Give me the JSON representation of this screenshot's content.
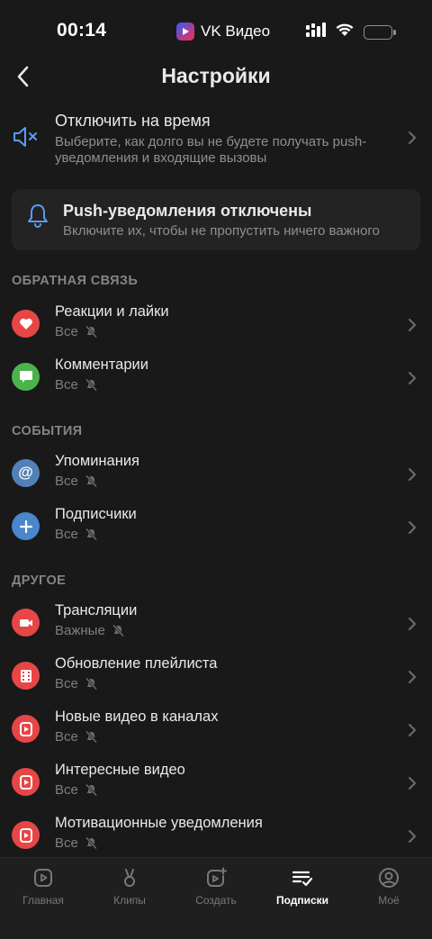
{
  "status_bar": {
    "time": "00:14",
    "app_name": "VK Видео",
    "battery_level": 0.22
  },
  "header": {
    "title": "Настройки"
  },
  "snooze": {
    "title": "Отключить на время",
    "description": "Выберите, как долго вы не будете получать push-уведомления и входящие вызовы"
  },
  "push_banner": {
    "title": "Push-уведомления отключены",
    "description": "Включите их, чтобы не пропустить ничего важного"
  },
  "sections": {
    "feedback": "ОБРАТНАЯ СВЯЗЬ",
    "events": "СОБЫТИЯ",
    "other": "ДРУГОЕ"
  },
  "rows": {
    "reactions": {
      "title": "Реакции и лайки",
      "sub": "Все",
      "icon": "heart-icon",
      "color": "#e64646"
    },
    "comments": {
      "title": "Комментарии",
      "sub": "Все",
      "icon": "comment-icon",
      "color": "#4bb34b"
    },
    "mentions": {
      "title": "Упоминания",
      "sub": "Все",
      "icon": "at-icon",
      "color": "#5181b8"
    },
    "subscribers": {
      "title": "Подписчики",
      "sub": "Все",
      "icon": "plus-icon",
      "color": "#4986cc"
    },
    "streams": {
      "title": "Трансляции",
      "sub": "Важные",
      "icon": "video-camera-icon",
      "color": "#e64646"
    },
    "playlist": {
      "title": "Обновление плейлиста",
      "sub": "Все",
      "icon": "film-icon",
      "color": "#e64646"
    },
    "channel_videos": {
      "title": "Новые видео в каналах",
      "sub": "Все",
      "icon": "play-icon",
      "color": "#e64646"
    },
    "interesting": {
      "title": "Интересные видео",
      "sub": "Все",
      "icon": "play-icon",
      "color": "#e64646"
    },
    "motivation": {
      "title": "Мотивационные уведомления",
      "sub": "Все",
      "icon": "play-icon",
      "color": "#e64646"
    }
  },
  "tabs": {
    "home": "Главная",
    "clips": "Клипы",
    "create": "Создать",
    "subscriptions": "Подписки",
    "mine": "Моё"
  }
}
